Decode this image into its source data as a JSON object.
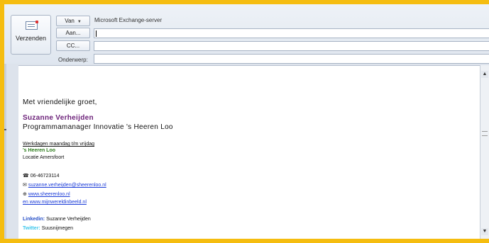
{
  "toolbar": {
    "send_label": "Verzenden",
    "from_label": "Van",
    "from_value": "Microsoft Exchange-server",
    "to_label": "Aan...",
    "cc_label": "CC...",
    "subject_label": "Onderwerp:"
  },
  "fields": {
    "to_value": "",
    "cc_value": "",
    "subject_value": ""
  },
  "signature": {
    "greeting": "Met vriendelijke groet,",
    "name": "Suzanne Verheijden",
    "role": "Programmamanager Innovatie 's Heeren Loo",
    "workdays": "Werkdagen maandag t/m vrijdag",
    "org": "'s Heeren Loo",
    "location": "Locatie Amersfoort",
    "phone": "06-46723114",
    "email": "suzanne.verheijden@sheerenloo.nl",
    "website": "www.sheerenloo.nl",
    "website2": " en www.mijnwereldinbeeld.nl",
    "linkedin_label": "Linkedin:",
    "linkedin_value": " Suzanne Verheijden",
    "twitter_label": "Twitter:",
    "twitter_value": " Suusnijmegen"
  },
  "colors": {
    "frame": "#f5bd10",
    "name": "#6b1f78",
    "org": "#2e7d1d",
    "link": "#1a3bd8",
    "linkedin": "#2750c8",
    "twitter": "#3cc6ec"
  },
  "icons": {
    "send": "send-mail-icon",
    "phone": "phone-icon",
    "email": "envelope-icon",
    "web": "globe-icon"
  }
}
